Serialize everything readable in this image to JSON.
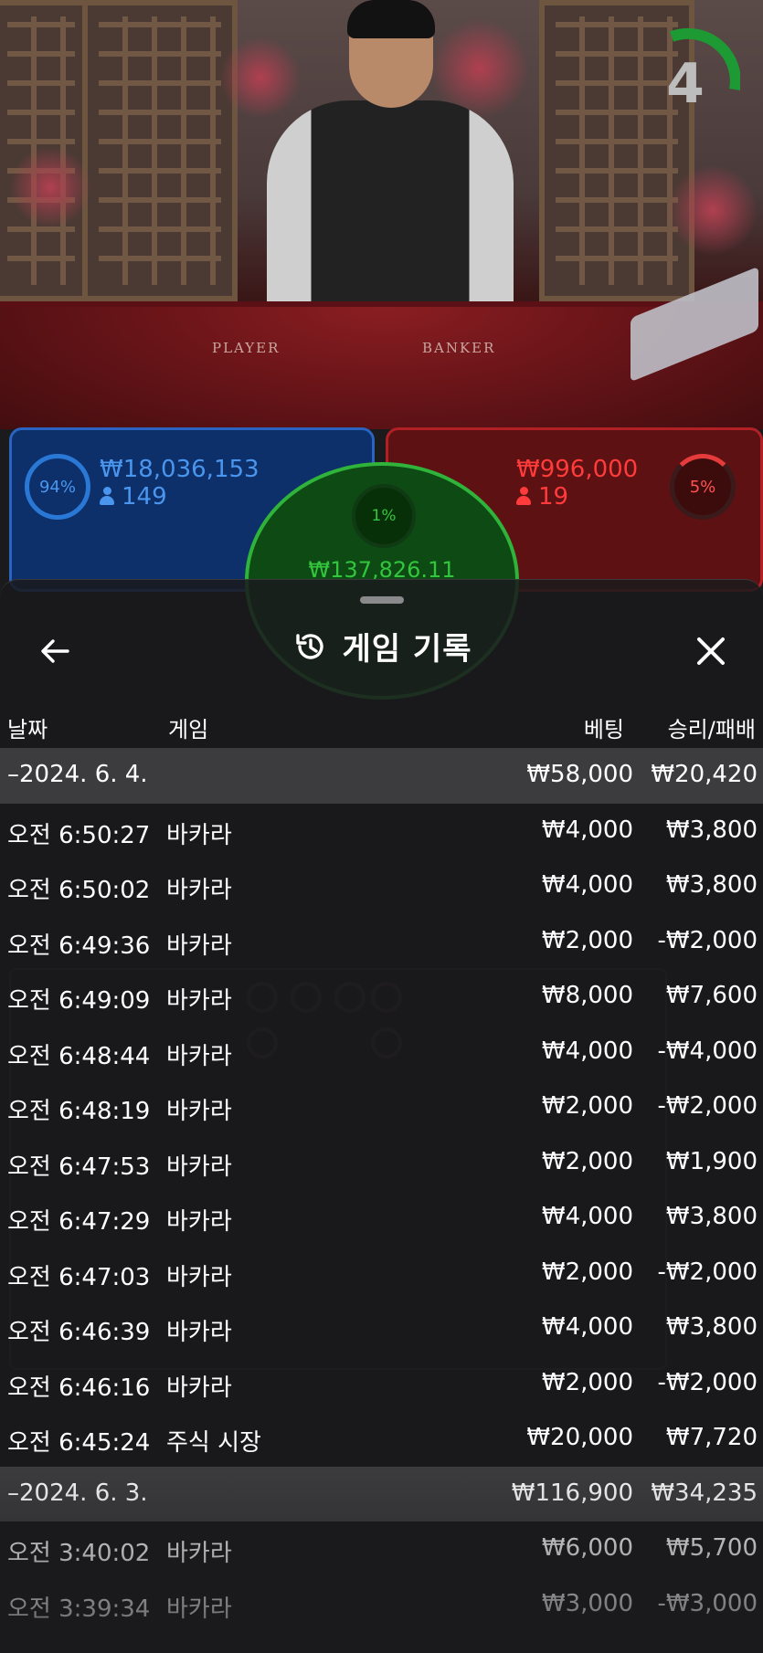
{
  "video": {
    "timer_value": "4",
    "table_labels": {
      "player": "PLAYER",
      "banker": "BANKER"
    }
  },
  "bets": {
    "player": {
      "percent": "94%",
      "amount": "₩18,036,153",
      "players": "149"
    },
    "banker": {
      "percent": "5%",
      "amount": "₩996,000",
      "players": "19"
    },
    "tie": {
      "percent": "1%",
      "amount": "₩137,826.11"
    }
  },
  "sheet": {
    "title": "게임 기록",
    "headers": {
      "date": "날짜",
      "game": "게임",
      "bet": "베팅",
      "result": "승리/패배"
    }
  },
  "history": [
    {
      "type": "group",
      "date": "–2024. 6. 4.",
      "bet": "₩58,000",
      "result": "₩20,420"
    },
    {
      "type": "row",
      "time": "오전 6:50:27",
      "game": "바카라",
      "bet": "₩4,000",
      "result": "₩3,800"
    },
    {
      "type": "row",
      "time": "오전 6:50:02",
      "game": "바카라",
      "bet": "₩4,000",
      "result": "₩3,800"
    },
    {
      "type": "row",
      "time": "오전 6:49:36",
      "game": "바카라",
      "bet": "₩2,000",
      "result": "-₩2,000"
    },
    {
      "type": "row",
      "time": "오전 6:49:09",
      "game": "바카라",
      "bet": "₩8,000",
      "result": "₩7,600"
    },
    {
      "type": "row",
      "time": "오전 6:48:44",
      "game": "바카라",
      "bet": "₩4,000",
      "result": "-₩4,000"
    },
    {
      "type": "row",
      "time": "오전 6:48:19",
      "game": "바카라",
      "bet": "₩2,000",
      "result": "-₩2,000"
    },
    {
      "type": "row",
      "time": "오전 6:47:53",
      "game": "바카라",
      "bet": "₩2,000",
      "result": "₩1,900"
    },
    {
      "type": "row",
      "time": "오전 6:47:29",
      "game": "바카라",
      "bet": "₩4,000",
      "result": "₩3,800"
    },
    {
      "type": "row",
      "time": "오전 6:47:03",
      "game": "바카라",
      "bet": "₩2,000",
      "result": "-₩2,000"
    },
    {
      "type": "row",
      "time": "오전 6:46:39",
      "game": "바카라",
      "bet": "₩4,000",
      "result": "₩3,800"
    },
    {
      "type": "row",
      "time": "오전 6:46:16",
      "game": "바카라",
      "bet": "₩2,000",
      "result": "-₩2,000"
    },
    {
      "type": "row",
      "time": "오전 6:45:24",
      "game": "주식 시장",
      "bet": "₩20,000",
      "result": "₩7,720"
    },
    {
      "type": "group",
      "date": "–2024. 6. 3.",
      "bet": "₩116,900",
      "result": "₩34,235"
    },
    {
      "type": "row",
      "time": "오전 3:40:02",
      "game": "바카라",
      "bet": "₩6,000",
      "result": "₩5,700"
    },
    {
      "type": "row",
      "time": "오전 3:39:34",
      "game": "바카라",
      "bet": "₩3,000",
      "result": "-₩3,000"
    }
  ],
  "colors": {
    "player_blue": "#2a63c0",
    "banker_red": "#b02025",
    "tie_green": "#2fb33a",
    "timer_green": "#1e9a35",
    "sheet_bg": "#1b1b1d",
    "group_row_bg": "#3c3c3e"
  },
  "icons": [
    "back-arrow-icon",
    "history-icon",
    "close-icon",
    "person-icon"
  ]
}
